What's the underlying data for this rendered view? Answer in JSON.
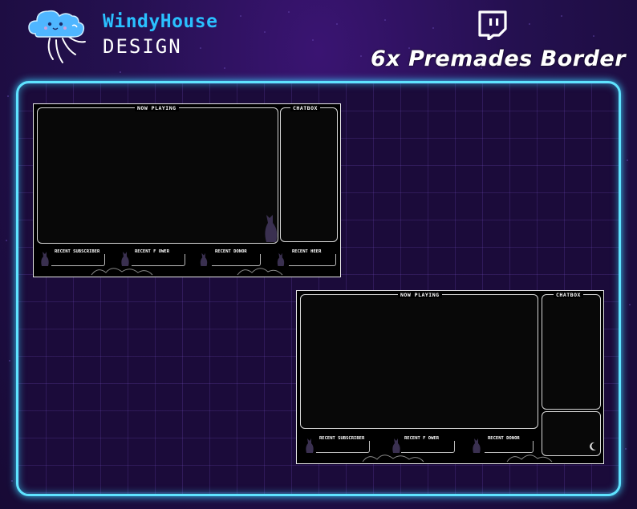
{
  "brand": {
    "name": "WindyHouse",
    "subtitle": "DESIGN"
  },
  "headline": "6x Premades Border",
  "icons": {
    "logo": "cloud-mascot-icon",
    "platform": "twitch-icon"
  },
  "colors": {
    "accent": "#2ac0ff",
    "panel_border": "#5fe3ff",
    "background": "#24104f"
  },
  "overlays": [
    {
      "now_playing": "NOW PLAYING",
      "chatbox": "CHATBOX",
      "labels": [
        "RECENT SUBSCRIBER",
        "RECENT F   OWER",
        "RECENT DONOR",
        "RECENT  HEER"
      ]
    },
    {
      "now_playing": "NOW PLAYING",
      "chatbox": "CHATBOX",
      "labels": [
        "RECENT SUBSCRIBER",
        "RECENT F   OWER",
        "RECENT DONOR"
      ]
    }
  ]
}
